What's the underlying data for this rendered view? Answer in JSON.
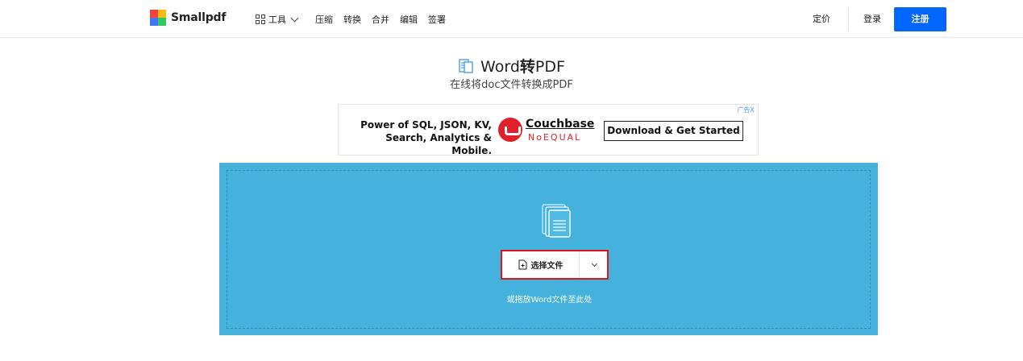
{
  "header": {
    "logo_text": "Smallpdf",
    "nav": {
      "tools_label": "工具",
      "links": [
        "压缩",
        "转换",
        "合并",
        "编辑",
        "签署"
      ]
    },
    "pricing_label": "定价",
    "login_label": "登录",
    "signup_label": "注册"
  },
  "hero": {
    "title_prefix": "Word",
    "title_bold": "转",
    "title_suffix": "PDF",
    "subtitle": "在线将doc文件转换成PDF"
  },
  "ad": {
    "badge": "广告X",
    "headline_line1": "Power of SQL, JSON, KV,",
    "headline_line2": "Search, Analytics & Mobile.",
    "brand_name": "Couchbase",
    "brand_tagline": "NoEQUAL",
    "cta_label": "Download & Get Started"
  },
  "dropzone": {
    "select_label": "选择文件",
    "hint": "或拖放Word文件至此处"
  },
  "colors": {
    "accent": "#0066ff",
    "dropzone_bg": "#44b2dc",
    "highlight_border": "#e0141e",
    "couchbase_red": "#e0202a"
  }
}
